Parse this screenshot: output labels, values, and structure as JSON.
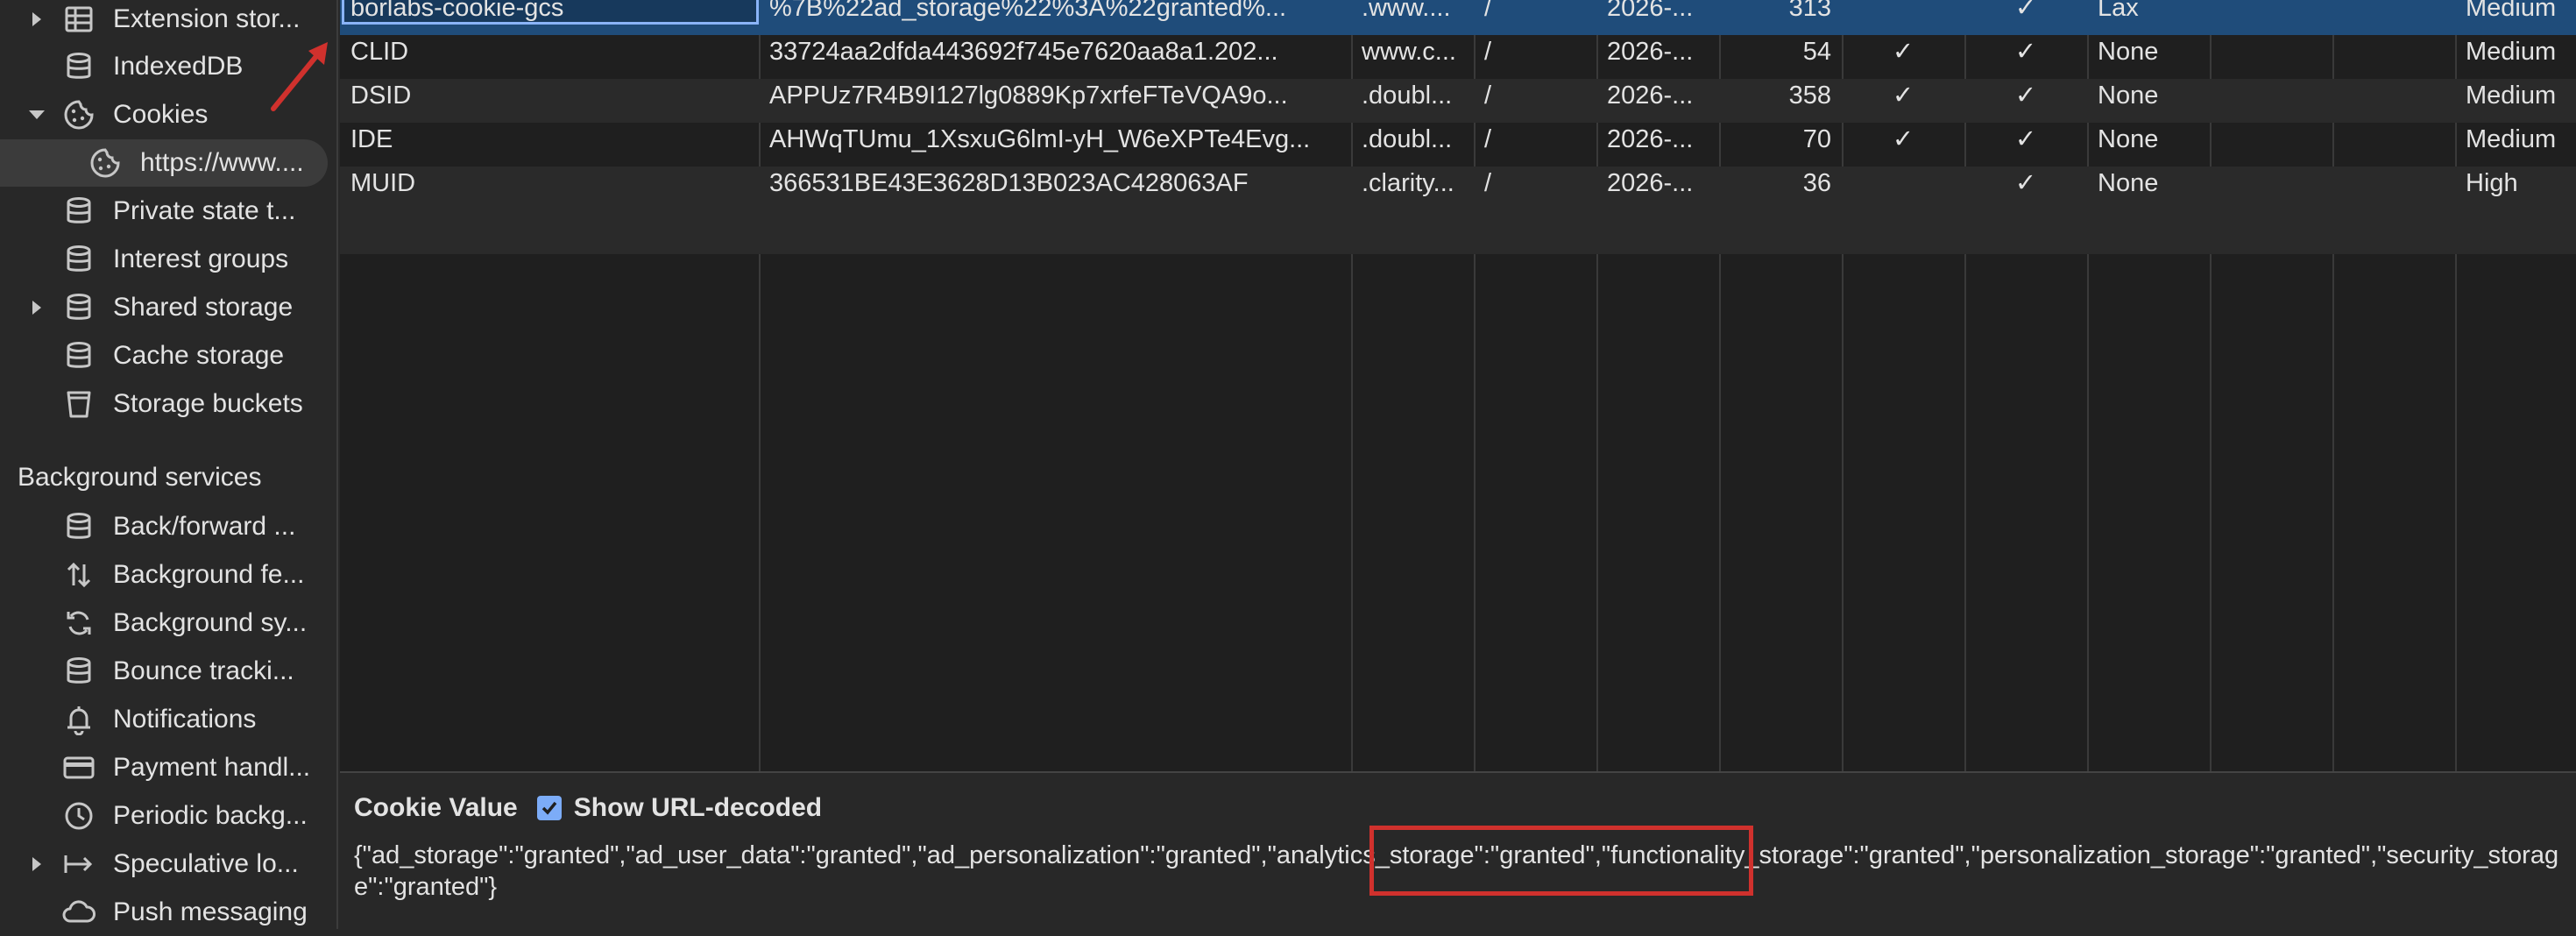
{
  "sidebar": {
    "items": [
      {
        "label": "Extension stor...",
        "icon": "table-icon",
        "expandable": true
      },
      {
        "label": "IndexedDB",
        "icon": "database-icon"
      },
      {
        "label": "Cookies",
        "icon": "cookie-icon",
        "expanded": true
      },
      {
        "label": "https://www....",
        "icon": "cookie-icon",
        "selected": true
      },
      {
        "label": "Private state t...",
        "icon": "database-icon"
      },
      {
        "label": "Interest groups",
        "icon": "database-icon"
      },
      {
        "label": "Shared storage",
        "icon": "database-icon",
        "expandable": true
      },
      {
        "label": "Cache storage",
        "icon": "database-icon"
      },
      {
        "label": "Storage buckets",
        "icon": "bucket-icon"
      }
    ],
    "section_title": "Background services",
    "bg_items": [
      {
        "label": "Back/forward ...",
        "icon": "database-icon"
      },
      {
        "label": "Background fe...",
        "icon": "up-down-arrows-icon"
      },
      {
        "label": "Background sy...",
        "icon": "sync-icon"
      },
      {
        "label": "Bounce tracki...",
        "icon": "database-icon"
      },
      {
        "label": "Notifications",
        "icon": "bell-icon"
      },
      {
        "label": "Payment handl...",
        "icon": "card-icon"
      },
      {
        "label": "Periodic backg...",
        "icon": "clock-icon"
      },
      {
        "label": "Speculative lo...",
        "icon": "arrow-to-bar-icon",
        "expandable": true
      },
      {
        "label": "Push messaging",
        "icon": "cloud-icon"
      }
    ]
  },
  "cookies": {
    "rows": [
      {
        "name": "borlabs-cookie-gcs",
        "value": "%7B%22ad_storage%22%3A%22granted%...",
        "domain": ".www....",
        "path": "/",
        "expires": "2026-...",
        "size": "313",
        "httponly": "",
        "secure": "✓",
        "samesite": "Lax",
        "priority": "Medium"
      },
      {
        "name": "CLID",
        "value": "33724aa2dfda443692f745e7620aa8a1.202...",
        "domain": "www.c...",
        "path": "/",
        "expires": "2026-...",
        "size": "54",
        "httponly": "✓",
        "secure": "✓",
        "samesite": "None",
        "priority": "Medium"
      },
      {
        "name": "DSID",
        "value": "APPUz7R4B9I127lg0889Kp7xrfeFTeVQA9o...",
        "domain": ".doubl...",
        "path": "/",
        "expires": "2026-...",
        "size": "358",
        "httponly": "✓",
        "secure": "✓",
        "samesite": "None",
        "priority": "Medium"
      },
      {
        "name": "IDE",
        "value": "AHWqTUmu_1XsxuG6lmI-yH_W6eXPTe4Evg...",
        "domain": ".doubl...",
        "path": "/",
        "expires": "2026-...",
        "size": "70",
        "httponly": "✓",
        "secure": "✓",
        "samesite": "None",
        "priority": "Medium"
      },
      {
        "name": "MUID",
        "value": "366531BE43E3628D13B023AC428063AF",
        "domain": ".clarity...",
        "path": "/",
        "expires": "2026-...",
        "size": "36",
        "httponly": "",
        "secure": "✓",
        "samesite": "None",
        "priority": "High"
      }
    ]
  },
  "panel": {
    "title": "Cookie Value",
    "checkbox_label": "Show URL-decoded",
    "checkbox_checked": true,
    "value_before": "{\"ad_storage\":\"granted\",\"ad_user_data\":\"granted\",\"ad_personalization\":\"granted\",",
    "value_highlight": "\"analytics_storage\":\"granted\"",
    "value_after": ",\"functionality_storage\":\"granted\",\"personalization_storage\":\"granted\",\"security_storage\":\"granted\"}"
  },
  "colors": {
    "selected_row": "#1f4c7a",
    "highlight_box": "#d0312d",
    "checkbox": "#7cacf8"
  }
}
